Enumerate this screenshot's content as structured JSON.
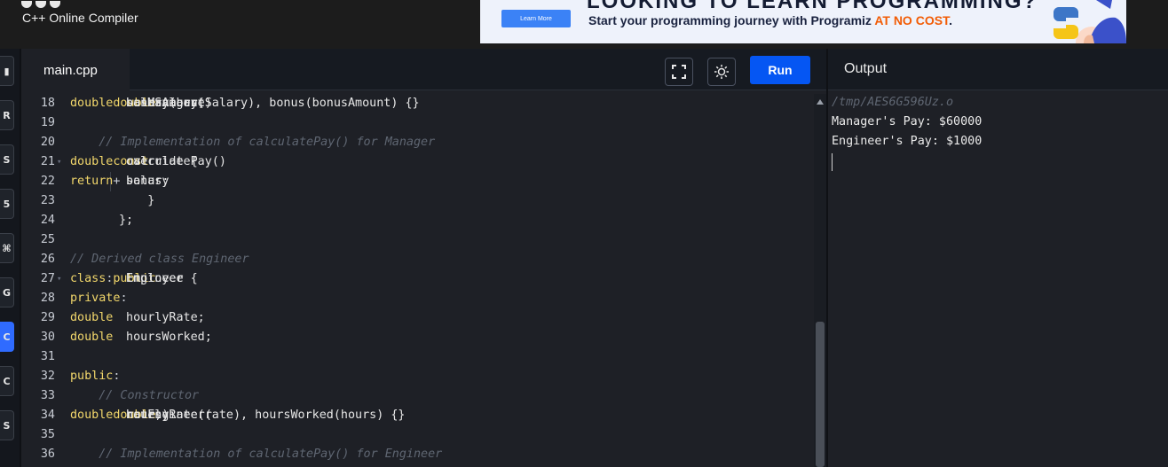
{
  "header": {
    "app_title": "C++ Online Compiler",
    "banner": {
      "headline": "LOOKING TO LEARN PROGRAMMING?",
      "button_label": "Learn More",
      "text_main": "Start your programming journey with Programiz ",
      "text_highlight": "AT NO COST",
      "text_end": ".",
      "highlight_color": "#f25c05"
    }
  },
  "sidebar": {
    "items": [
      {
        "icon": "language-icon-1",
        "glyph": "▮"
      },
      {
        "icon": "language-icon-2",
        "glyph": "R"
      },
      {
        "icon": "language-icon-3",
        "glyph": "S"
      },
      {
        "icon": "language-icon-4",
        "glyph": "5"
      },
      {
        "icon": "language-icon-5",
        "glyph": "⌘"
      },
      {
        "icon": "language-icon-6",
        "glyph": "G"
      },
      {
        "icon": "cpp-icon",
        "glyph": "C",
        "active": true
      },
      {
        "icon": "language-icon-8",
        "glyph": "C"
      },
      {
        "icon": "language-icon-9",
        "glyph": "S"
      }
    ]
  },
  "editor": {
    "tab_label": "main.cpp",
    "run_label": "Run",
    "lines": [
      {
        "n": "18",
        "fold": false,
        "tokens": [
          {
            "t": "    Manager(",
            "c": "src"
          },
          {
            "t": "double",
            "c": "kw"
          },
          {
            "t": " baseSalary, ",
            "c": "src"
          },
          {
            "t": "double",
            "c": "kw"
          },
          {
            "t": " bonusAmount) ",
            "c": "src"
          },
          {
            "t": ":",
            "c": "op"
          },
          {
            "t": " salary(baseSalary), bonus(bonusAmount) {}",
            "c": "src"
          }
        ]
      },
      {
        "n": "19",
        "fold": false,
        "tokens": []
      },
      {
        "n": "20",
        "fold": false,
        "tokens": [
          {
            "t": "    // Implementation of calculatePay() for Manager",
            "c": "cm"
          }
        ]
      },
      {
        "n": "21",
        "fold": true,
        "tokens": [
          {
            "t": "    ",
            "c": "src"
          },
          {
            "t": "double",
            "c": "kw"
          },
          {
            "t": " calculatePay() ",
            "c": "src"
          },
          {
            "t": "const",
            "c": "kw"
          },
          {
            "t": " override {",
            "c": "src"
          }
        ]
      },
      {
        "n": "22",
        "fold": false,
        "guide": true,
        "tokens": [
          {
            "t": "        ",
            "c": "src"
          },
          {
            "t": "return",
            "c": "kw"
          },
          {
            "t": " salary ",
            "c": "src"
          },
          {
            "t": "+",
            "c": "op"
          },
          {
            "t": " bonus;",
            "c": "src"
          }
        ]
      },
      {
        "n": "23",
        "fold": false,
        "tokens": [
          {
            "t": "    }",
            "c": "src"
          }
        ]
      },
      {
        "n": "24",
        "fold": false,
        "tokens": [
          {
            "t": "};",
            "c": "src"
          }
        ]
      },
      {
        "n": "25",
        "fold": false,
        "tokens": []
      },
      {
        "n": "26",
        "fold": false,
        "tokens": [
          {
            "t": "// Derived class Engineer",
            "c": "cm"
          }
        ]
      },
      {
        "n": "27",
        "fold": true,
        "tokens": [
          {
            "t": "class",
            "c": "kw"
          },
          {
            "t": " Engineer ",
            "c": "src"
          },
          {
            "t": ":",
            "c": "op"
          },
          {
            "t": " ",
            "c": "src"
          },
          {
            "t": "public",
            "c": "kw"
          },
          {
            "t": " Employee {",
            "c": "src"
          }
        ]
      },
      {
        "n": "28",
        "fold": false,
        "tokens": [
          {
            "t": "private",
            "c": "kw"
          },
          {
            "t": ":",
            "c": "op"
          }
        ]
      },
      {
        "n": "29",
        "fold": false,
        "tokens": [
          {
            "t": "    ",
            "c": "src"
          },
          {
            "t": "double",
            "c": "kw"
          },
          {
            "t": " hourlyRate;",
            "c": "src"
          }
        ]
      },
      {
        "n": "30",
        "fold": false,
        "tokens": [
          {
            "t": "    ",
            "c": "src"
          },
          {
            "t": "double",
            "c": "kw"
          },
          {
            "t": " hoursWorked;",
            "c": "src"
          }
        ]
      },
      {
        "n": "31",
        "fold": false,
        "tokens": []
      },
      {
        "n": "32",
        "fold": false,
        "tokens": [
          {
            "t": "public",
            "c": "kw"
          },
          {
            "t": ":",
            "c": "op"
          }
        ]
      },
      {
        "n": "33",
        "fold": false,
        "tokens": [
          {
            "t": "    // Constructor",
            "c": "cm"
          }
        ]
      },
      {
        "n": "34",
        "fold": false,
        "tokens": [
          {
            "t": "    Engineer(",
            "c": "src"
          },
          {
            "t": "double",
            "c": "kw"
          },
          {
            "t": " rate, ",
            "c": "src"
          },
          {
            "t": "double",
            "c": "kw"
          },
          {
            "t": " hours) ",
            "c": "src"
          },
          {
            "t": ":",
            "c": "op"
          },
          {
            "t": " hourlyRate(rate), hoursWorked(hours) {}",
            "c": "src"
          }
        ]
      },
      {
        "n": "35",
        "fold": false,
        "tokens": []
      },
      {
        "n": "36",
        "fold": false,
        "tokens": [
          {
            "t": "    // Implementation of calculatePay() for Engineer",
            "c": "cm"
          }
        ]
      }
    ]
  },
  "output": {
    "title": "Output",
    "path": "/tmp/AES6G596Uz.o",
    "lines": [
      "Manager's Pay: $60000",
      "Engineer's Pay: $1000"
    ]
  },
  "colors": {
    "accent": "#0556f3",
    "keyword": "#f2d76b",
    "comment": "#5f6672",
    "editor_bg": "#1e2026"
  }
}
